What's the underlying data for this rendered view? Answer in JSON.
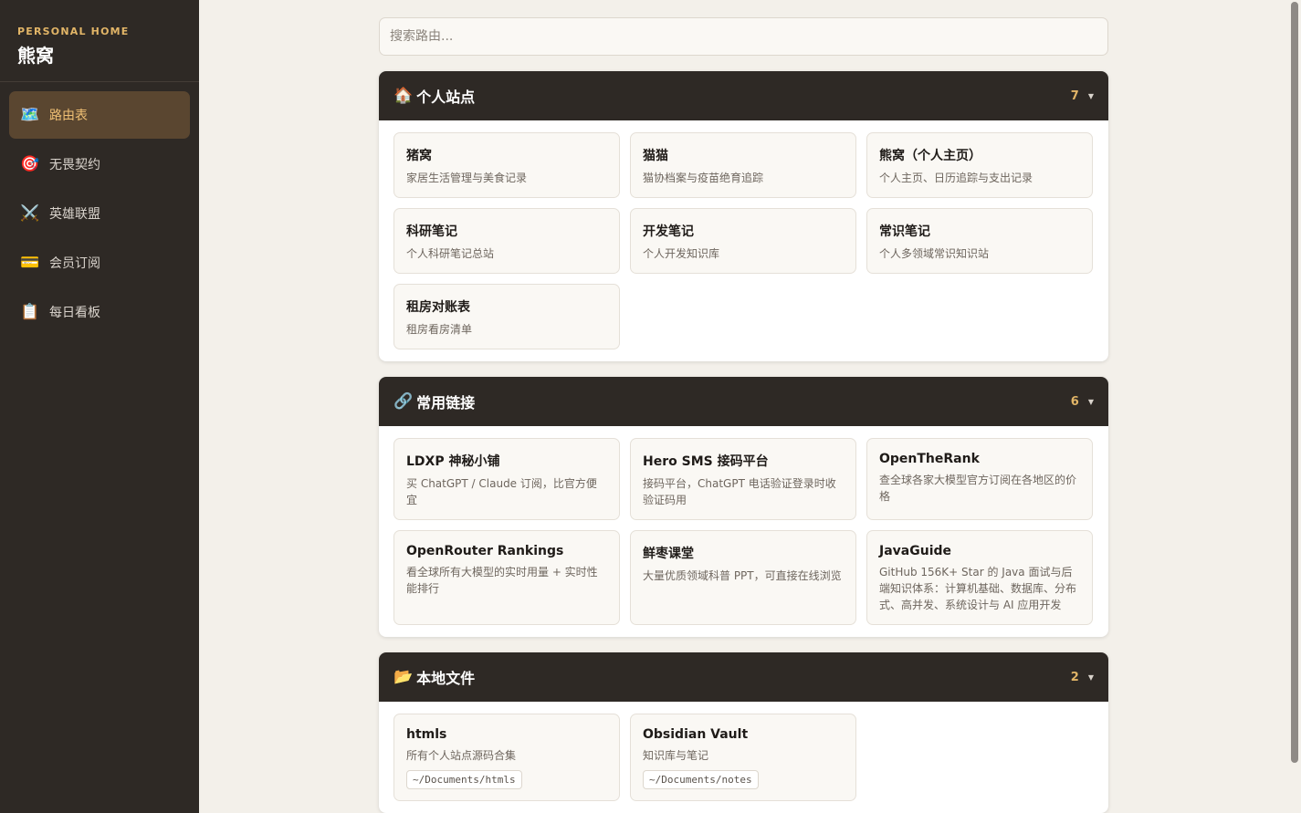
{
  "sidebar": {
    "brand_sub": "PERSONAL HOME",
    "brand_title": "熊窝",
    "items": [
      {
        "icon": "🗺️",
        "label": "路由表",
        "active": true
      },
      {
        "icon": "🎯",
        "label": "无畏契约"
      },
      {
        "icon": "⚔️",
        "label": "英雄联盟"
      },
      {
        "icon": "💳",
        "label": "会员订阅"
      },
      {
        "icon": "📋",
        "label": "每日看板"
      }
    ]
  },
  "search": {
    "placeholder": "搜索路由..."
  },
  "sections": [
    {
      "emoji": "🏠",
      "title": "个人站点",
      "count": "7",
      "caret": "▼",
      "cards": [
        {
          "title": "猪窝",
          "desc": "家居生活管理与美食记录"
        },
        {
          "title": "猫猫",
          "desc": "猫协档案与疫苗绝育追踪"
        },
        {
          "title": "熊窝（个人主页）",
          "desc": "个人主页、日历追踪与支出记录"
        },
        {
          "title": "科研笔记",
          "desc": "个人科研笔记总站"
        },
        {
          "title": "开发笔记",
          "desc": "个人开发知识库"
        },
        {
          "title": "常识笔记",
          "desc": "个人多领域常识知识站"
        },
        {
          "title": "租房对账表",
          "desc": "租房看房清单"
        }
      ]
    },
    {
      "emoji": "🔗",
      "title": "常用链接",
      "count": "6",
      "caret": "▼",
      "cards": [
        {
          "title": "LDXP 神秘小铺",
          "desc": "买 ChatGPT / Claude 订阅，比官方便宜"
        },
        {
          "title": "Hero SMS 接码平台",
          "desc": "接码平台，ChatGPT 电话验证登录时收验证码用"
        },
        {
          "title": "OpenTheRank",
          "desc": "查全球各家大模型官方订阅在各地区的价格"
        },
        {
          "title": "OpenRouter Rankings",
          "desc": "看全球所有大模型的实时用量 + 实时性能排行"
        },
        {
          "title": "鲜枣课堂",
          "desc": "大量优质领域科普 PPT，可直接在线浏览"
        },
        {
          "title": "JavaGuide",
          "desc": "GitHub 156K+ Star 的 Java 面试与后端知识体系：计算机基础、数据库、分布式、高并发、系统设计与 AI 应用开发"
        }
      ]
    },
    {
      "emoji": "📂",
      "title": "本地文件",
      "count": "2",
      "caret": "▼",
      "cards": [
        {
          "title": "htmls",
          "desc": "所有个人站点源码合集",
          "path": "~/Documents/htmls"
        },
        {
          "title": "Obsidian Vault",
          "desc": "知识库与笔记",
          "path": "~/Documents/notes"
        }
      ]
    }
  ]
}
